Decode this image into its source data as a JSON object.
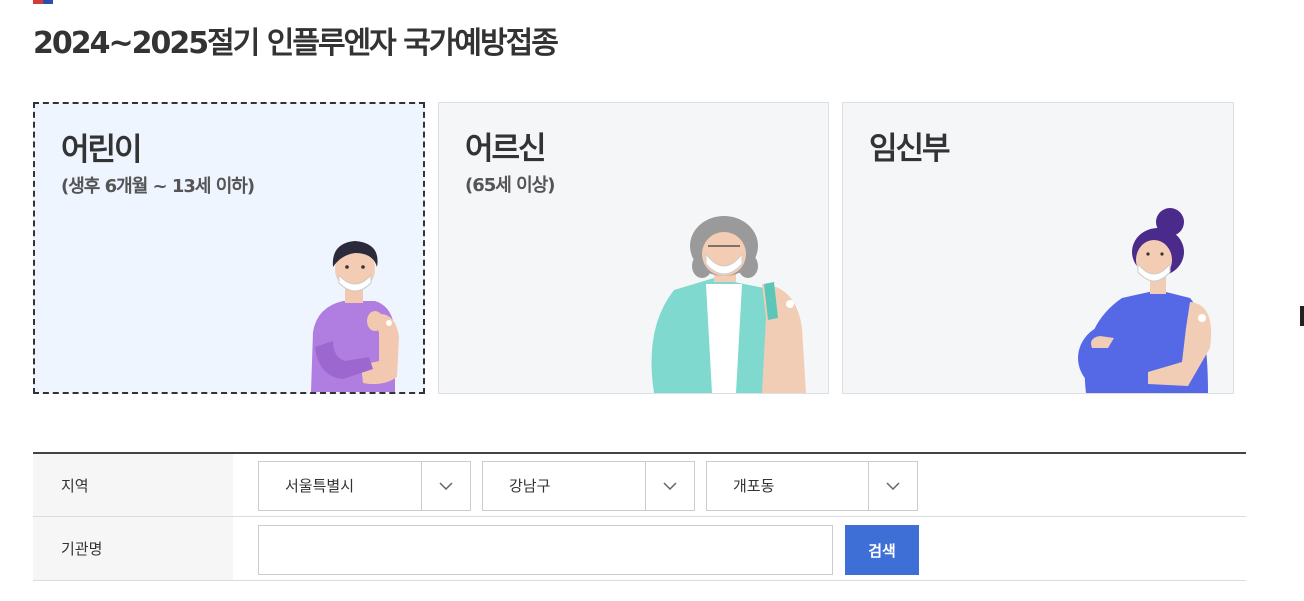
{
  "page": {
    "title": "2024~2025절기 인플루엔자 국가예방접종"
  },
  "categories": [
    {
      "title": "어린이",
      "subtitle": "(생후 6개월 ~ 13세 이하)",
      "selected": true
    },
    {
      "title": "어르신",
      "subtitle": "(65세 이상)",
      "selected": false
    },
    {
      "title": "임신부",
      "subtitle": "",
      "selected": false
    }
  ],
  "search": {
    "region_label": "지역",
    "city_value": "서울특별시",
    "district_value": "강남구",
    "dong_value": "개포동",
    "org_label": "기관명",
    "org_value": "",
    "org_placeholder": "",
    "search_button": "검색"
  },
  "colors": {
    "accent": "#3d6fd6",
    "selected_card_bg": "#eef5ff",
    "card_bg": "#f5f6f8"
  }
}
